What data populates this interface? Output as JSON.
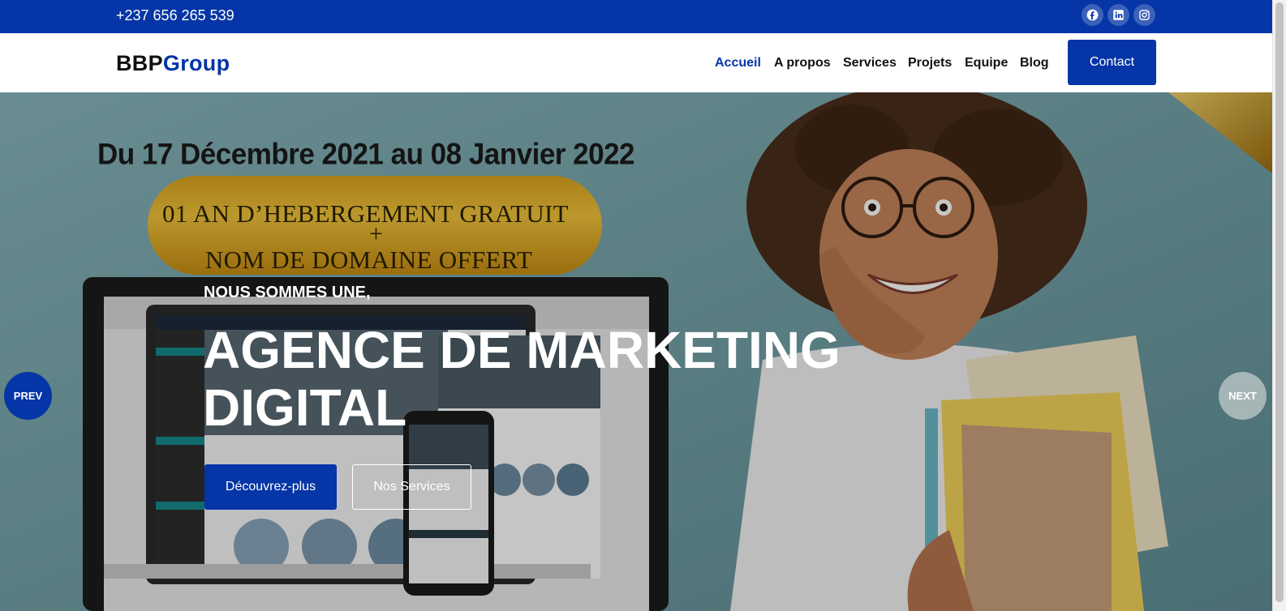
{
  "topbar": {
    "phone": "+237 656 265 539",
    "social": [
      "facebook-icon",
      "linkedin-icon",
      "instagram-icon"
    ]
  },
  "brand": {
    "part1": "BBP",
    "part2": "Group"
  },
  "nav": {
    "items": [
      "Accueil",
      "A propos",
      "Services",
      "Projets",
      "Equipe",
      "Blog"
    ],
    "active": "Accueil",
    "contact_label": "Contact"
  },
  "hero": {
    "promo": {
      "dates": "Du 17 Décembre 2021  au 08 Janvier 2022",
      "line1": "01 AN D’HEBERGEMENT GRATUIT",
      "plus": "+",
      "line2": "NOM DE DOMAINE OFFERT"
    },
    "kicker": "NOUS SOMMES UNE,",
    "headline": "AGENCE DE MARKETING DIGITAL",
    "primary_button": "Découvrez-plus",
    "secondary_button": "Nos Services",
    "prev_label": "PREV",
    "next_label": "NEXT"
  },
  "colors": {
    "brand_blue": "#0535a6",
    "white": "#ffffff"
  }
}
